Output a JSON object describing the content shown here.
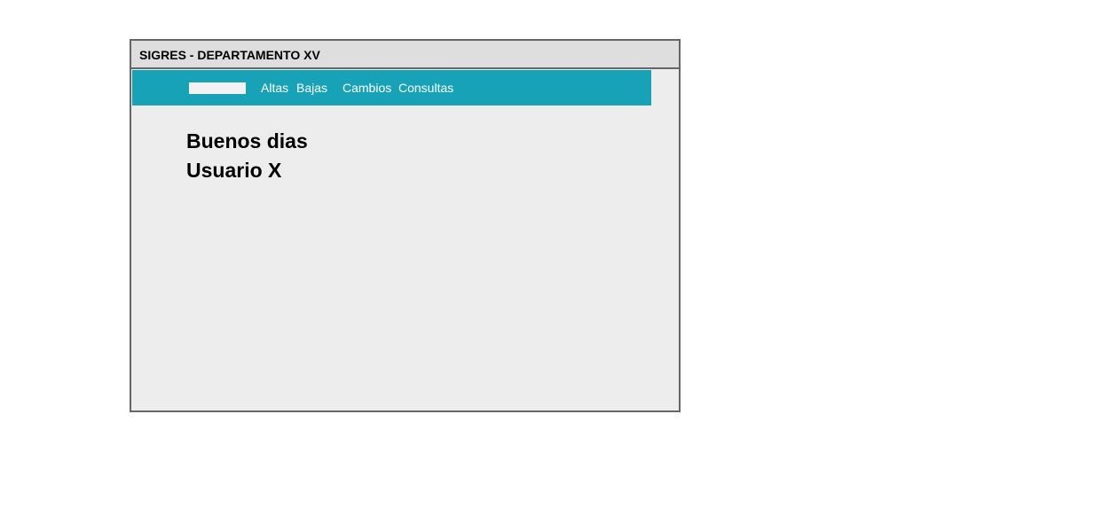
{
  "window": {
    "title": "SIGRES - DEPARTAMENTO XV"
  },
  "navbar": {
    "background_color": "#17a2b8",
    "search": {
      "value": "",
      "placeholder": ""
    },
    "items": [
      {
        "label": "Altas"
      },
      {
        "label": "Bajas"
      },
      {
        "label": "Cambios"
      },
      {
        "label": "Consultas"
      }
    ]
  },
  "main": {
    "greeting_line1": "Buenos dias",
    "greeting_line2": "Usuario X"
  }
}
